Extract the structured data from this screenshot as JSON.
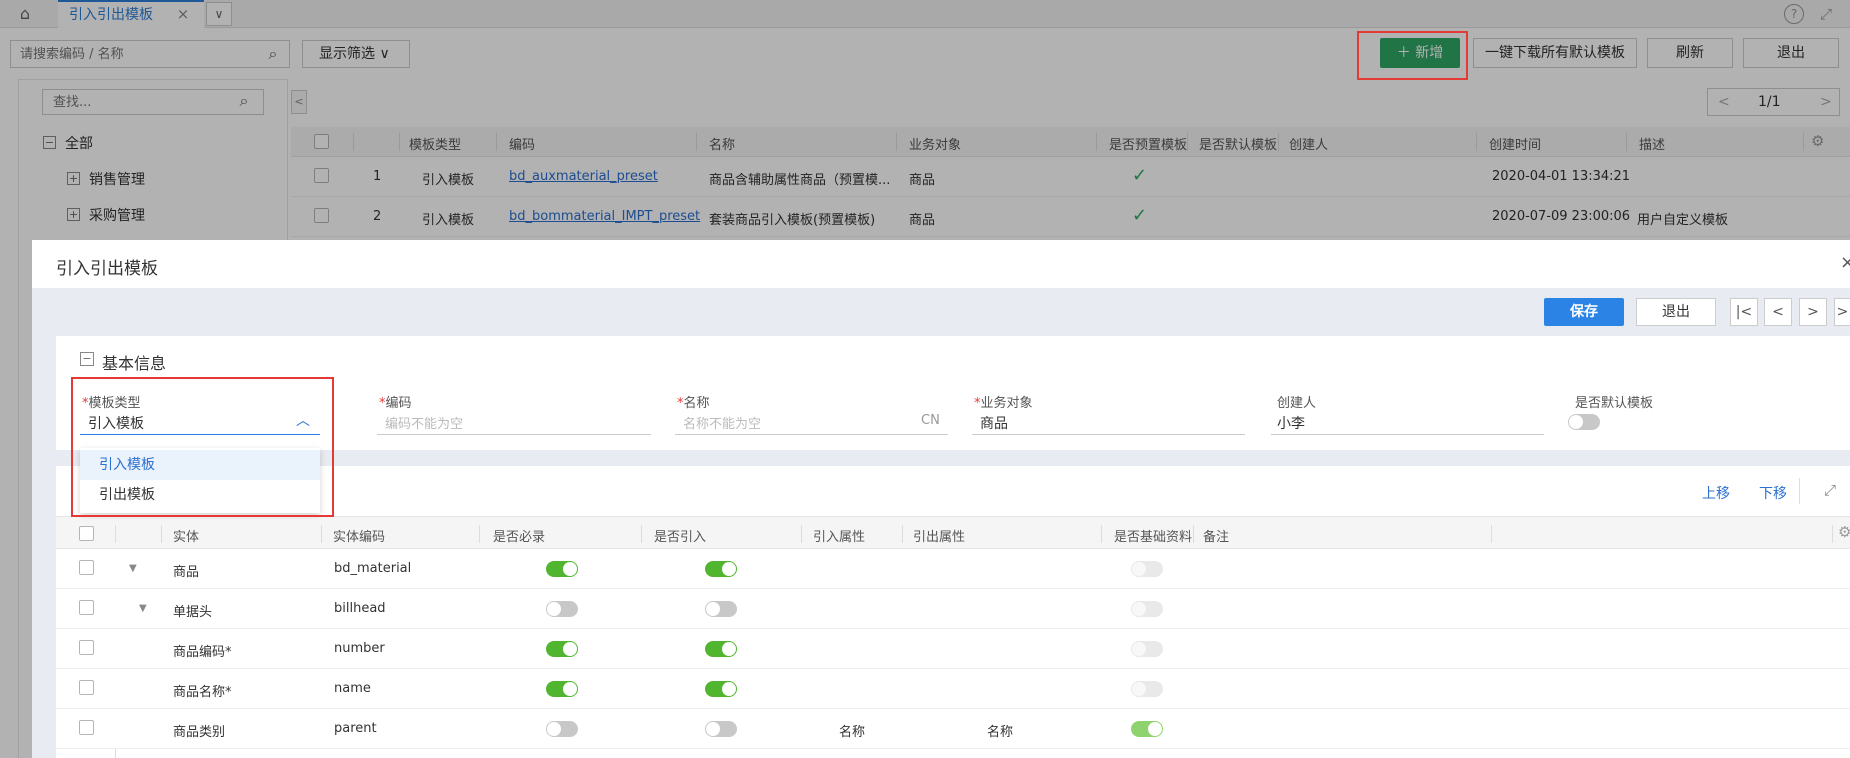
{
  "tabbar": {
    "home_icon": "home-icon",
    "tab_label": "引入引出模板",
    "close": "×",
    "more": "∨"
  },
  "toolbar": {
    "search_placeholder": "请搜索编码 / 名称",
    "filter_label": "显示筛选",
    "add_label": "新增",
    "download_label": "一键下载所有默认模板",
    "refresh_label": "刷新",
    "exit_label": "退出"
  },
  "tree": {
    "search_placeholder": "查找...",
    "items": [
      {
        "label": "全部",
        "icon": "⊟"
      },
      {
        "label": "销售管理",
        "icon": "⊞"
      },
      {
        "label": "采购管理",
        "icon": "⊞"
      }
    ]
  },
  "list": {
    "pager": "1/1",
    "columns": [
      "模板类型",
      "编码",
      "名称",
      "业务对象",
      "是否预置模板",
      "是否默认模板",
      "创建人",
      "创建时间",
      "描述"
    ],
    "rows": [
      {
        "index": "1",
        "type": "引入模板",
        "code": "bd_auxmaterial_preset",
        "name": "商品含辅助属性商品（预置模...",
        "object": "商品",
        "preset": "✓",
        "creator": "",
        "created": "2020-04-01 13:34:21",
        "desc": ""
      },
      {
        "index": "2",
        "type": "引入模板",
        "code": "bd_bommaterial_IMPT_preset",
        "name": "套装商品引入模板(预置模板)",
        "object": "商品",
        "preset": "✓",
        "creator": "",
        "created": "2020-07-09 23:00:06",
        "desc": "用户自定义模板"
      }
    ]
  },
  "modal": {
    "title": "引入引出模板",
    "close": "×",
    "save_label": "保存",
    "exit_label": "退出",
    "nav": [
      "|<",
      "<",
      ">",
      ">"
    ],
    "section_title": "基本信息",
    "section_icon": "⊟",
    "fields": {
      "type": {
        "req": "*",
        "label": "模板类型",
        "value": "引入模板",
        "arrow": "^"
      },
      "code": {
        "req": "*",
        "label": "编码",
        "placeholder": "编码不能为空"
      },
      "name": {
        "req": "*",
        "label": "名称",
        "placeholder": "名称不能为空",
        "suffix": "CN"
      },
      "object": {
        "req": "*",
        "label": "业务对象",
        "value": "商品"
      },
      "creator": {
        "label": "创建人",
        "value": "小李"
      },
      "is_default": {
        "label": "是否默认模板",
        "value": false
      }
    },
    "dropdown": [
      "引入模板",
      "引出模板"
    ],
    "entity_actions": {
      "up": "上移",
      "down": "下移"
    },
    "entity_columns": [
      "实体",
      "实体编码",
      "是否必录",
      "是否引入",
      "引入属性",
      "引出属性",
      "是否基础资料",
      "备注"
    ],
    "entity_rows": [
      {
        "entity": "商品",
        "code": "bd_material",
        "required": true,
        "imported": true,
        "import_attr": "",
        "export_attr": "",
        "basic": false,
        "caret": "▼"
      },
      {
        "entity": "单据头",
        "code": "billhead",
        "required": false,
        "imported": false,
        "import_attr": "",
        "export_attr": "",
        "basic": false,
        "caret": "▼"
      },
      {
        "entity": "商品编码*",
        "code": "number",
        "required": true,
        "imported": true,
        "import_attr": "",
        "export_attr": "",
        "basic": false,
        "caret": ""
      },
      {
        "entity": "商品名称*",
        "code": "name",
        "required": true,
        "imported": true,
        "import_attr": "",
        "export_attr": "",
        "basic": false,
        "caret": ""
      },
      {
        "entity": "商品类别",
        "code": "parent",
        "required": false,
        "imported": false,
        "import_attr": "名称",
        "export_attr": "名称",
        "basic": true,
        "caret": ""
      }
    ]
  },
  "colors": {
    "accent": "#2b84e5",
    "add_green": "#2fa764",
    "highlight": "#e53935",
    "toggle_on": "#52b52f"
  }
}
